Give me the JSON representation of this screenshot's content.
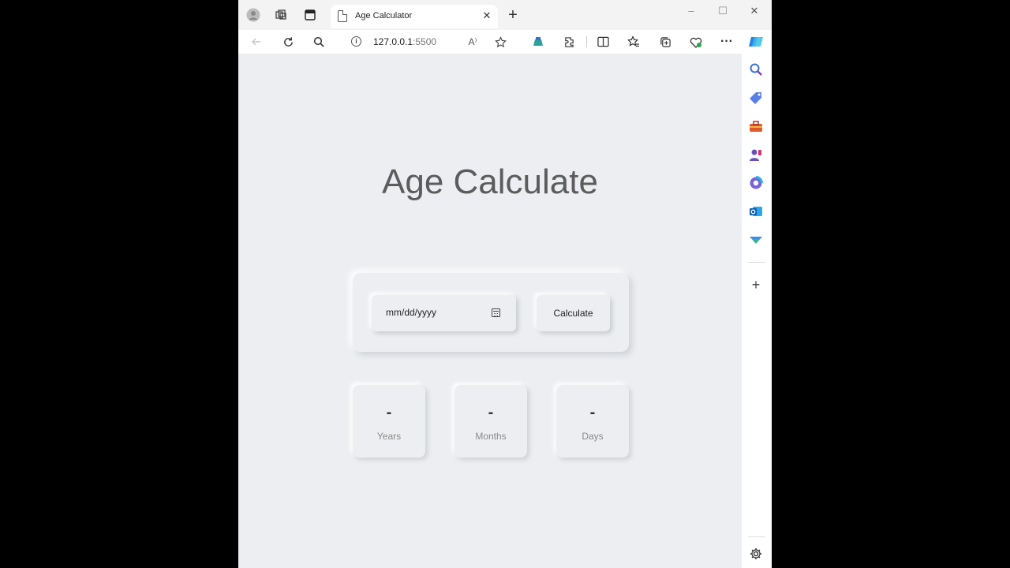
{
  "browser": {
    "tab_title": "Age Calculator",
    "url_host": "127.0.0.1",
    "url_port": ":5500",
    "icons": [
      "profile-icon",
      "workspaces-icon",
      "tab-actions-icon",
      "new-tab-icon",
      "back-icon",
      "refresh-icon",
      "search-icon",
      "site-info-icon",
      "read-aloud-icon",
      "favorite-star-icon",
      "extension-icon",
      "extensions-icon",
      "split-screen-icon",
      "favorites-icon",
      "collections-icon",
      "browser-essentials-icon",
      "more-icon",
      "copilot-icon"
    ],
    "read_aloud_glyph": "A⁾",
    "more_glyph": "···"
  },
  "page": {
    "title": "Age Calculate",
    "date_placeholder": "mm/dd/yyyy",
    "calculate_label": "Calculate",
    "results": [
      {
        "value": "-",
        "label": "Years"
      },
      {
        "value": "-",
        "label": "Months"
      },
      {
        "value": "-",
        "label": "Days"
      }
    ]
  },
  "sidebar": {
    "items": [
      "search-icon",
      "tag-icon",
      "toolbox-icon",
      "games-icon",
      "microsoft365-icon",
      "outlook-icon",
      "drop-icon",
      "add-icon",
      "settings-icon"
    ]
  },
  "colors": {
    "page_bg": "#eceef1",
    "title": "#5c5c5c",
    "label": "#8a8a8a"
  }
}
